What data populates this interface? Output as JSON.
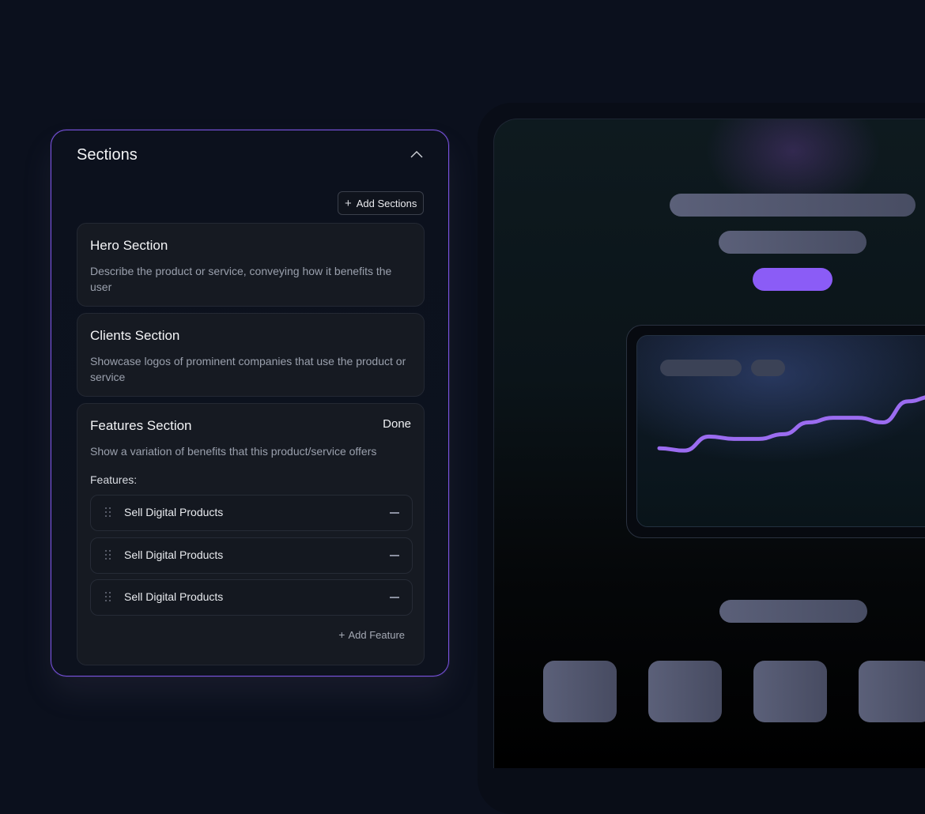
{
  "sections_panel": {
    "title": "Sections",
    "add_sections_label": "Add Sections",
    "cards": [
      {
        "title": "Hero Section",
        "description": "Describe the product or service, conveying how it benefits the user"
      },
      {
        "title": "Clients Section",
        "description": "Showcase logos of prominent companies that use the product or service"
      },
      {
        "title": "Features Section",
        "description": "Show a variation of benefits that this product/service offers",
        "done_label": "Done",
        "features_label": "Features:",
        "features": [
          "Sell Digital Products",
          "Sell Digital Products",
          "Sell Digital Products"
        ],
        "add_feature_label": "Add Feature"
      }
    ]
  },
  "preview": {
    "accent_color": "#8b5cf6",
    "skeleton_color": "#5b6079",
    "chart_line_color": "#9b6cf0",
    "chart_data": {
      "type": "line",
      "series": [
        {
          "values": [
            6,
            5,
            11,
            10,
            10,
            12,
            17,
            19,
            19,
            17,
            26,
            28,
            32
          ]
        }
      ]
    }
  }
}
